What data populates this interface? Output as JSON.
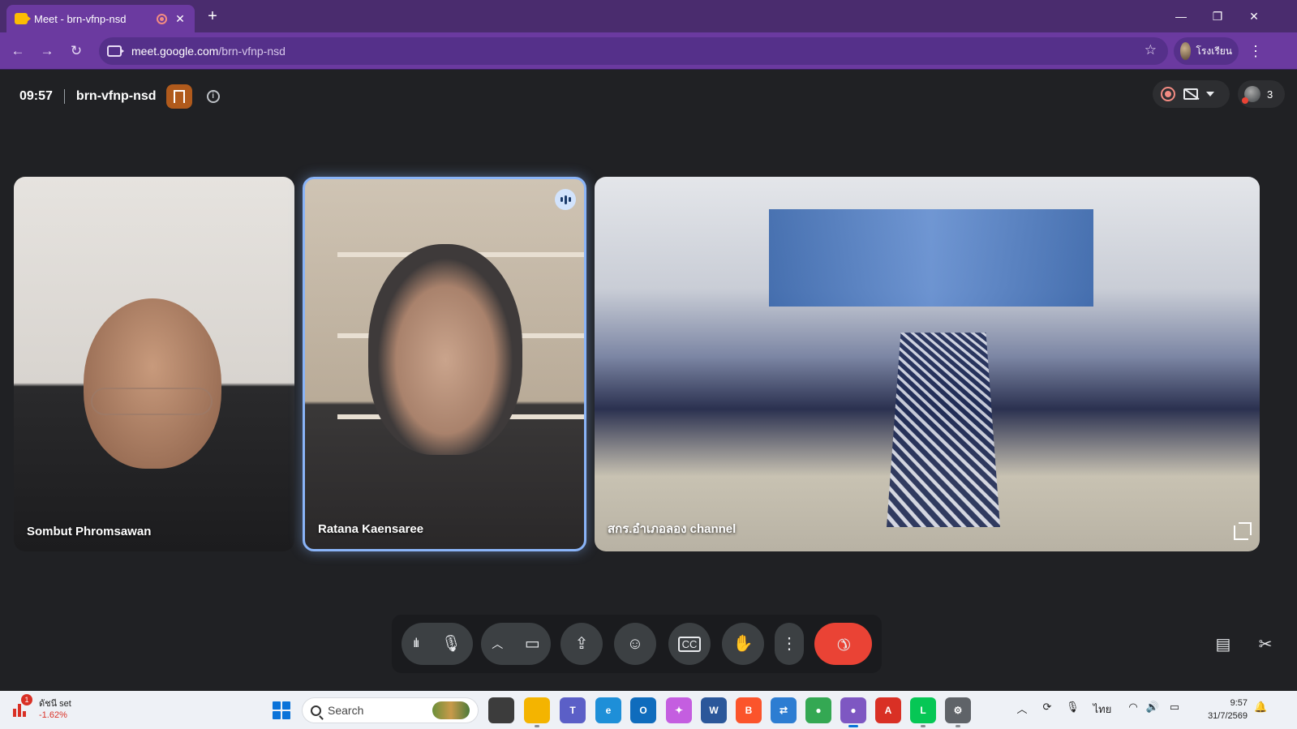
{
  "browser": {
    "tab_title": "Meet - brn-vfnp-nsd",
    "new_tab": "+",
    "window_controls": {
      "minimize": "—",
      "restore": "❐",
      "close": "✕"
    },
    "url_domain": "meet.google.com",
    "url_path": "/brn-vfnp-nsd",
    "profile_name": "โรงเรียน",
    "accent_color": "#6b3aa0"
  },
  "meeting": {
    "time": "09:57",
    "code": "brn-vfnp-nsd",
    "participant_count": "3",
    "participants": [
      {
        "name": "Sombut Phromsawan",
        "speaking": false
      },
      {
        "name": "Ratana Kaensaree",
        "speaking": true
      },
      {
        "name": "สกร.อำเภอลอง channel",
        "speaking": false
      }
    ]
  },
  "controls": {
    "icons": [
      "audio-levels-icon",
      "microphone-icon",
      "chevron-up-icon",
      "camera-icon",
      "present-screen-icon",
      "emoji-icon",
      "captions-icon",
      "raise-hand-icon",
      "more-options-icon",
      "end-call-icon",
      "chat-icon",
      "activities-icon"
    ],
    "end_call_color": "#ea4335"
  },
  "taskbar": {
    "stock_label": "ดัชนี set",
    "stock_change": "-1.62%",
    "stock_badge": "1",
    "search_placeholder": "Search",
    "language": "ไทย",
    "clock_time": "9:57",
    "clock_date": "31/7/2569"
  }
}
